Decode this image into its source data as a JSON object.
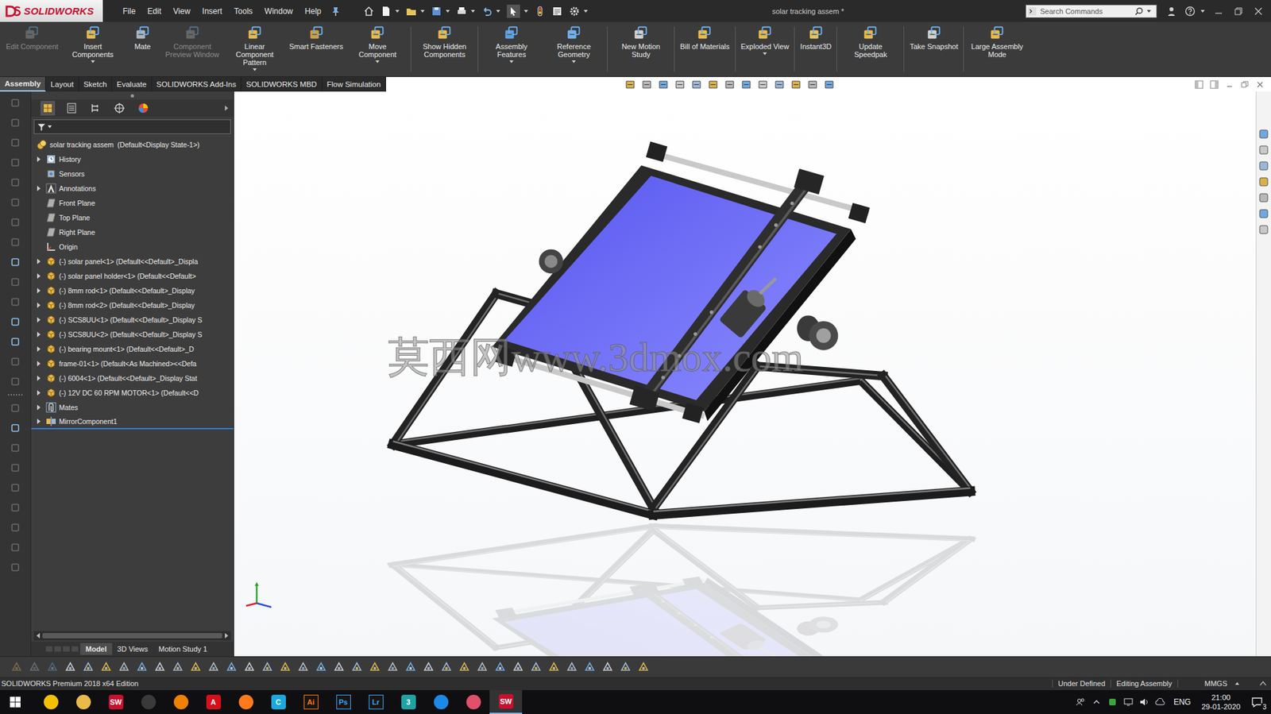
{
  "window": {
    "title": "solar tracking assem *",
    "app": "SOLIDWORKS"
  },
  "menu": [
    "File",
    "Edit",
    "View",
    "Insert",
    "Tools",
    "Window",
    "Help"
  ],
  "search": {
    "placeholder": "Search Commands"
  },
  "ribbon": [
    {
      "label": "Edit Component",
      "disabled": true,
      "dropdown": false
    },
    {
      "label": "Insert Components",
      "disabled": false,
      "dropdown": true
    },
    {
      "label": "Mate",
      "disabled": false,
      "dropdown": false
    },
    {
      "label": "Component Preview Window",
      "disabled": true,
      "dropdown": false
    },
    {
      "label": "Linear Component Pattern",
      "disabled": false,
      "dropdown": true
    },
    {
      "label": "Smart Fasteners",
      "disabled": false,
      "dropdown": false
    },
    {
      "label": "Move Component",
      "disabled": false,
      "dropdown": true
    },
    {
      "label": "Show Hidden Components",
      "disabled": false,
      "dropdown": false
    },
    {
      "label": "Assembly Features",
      "disabled": false,
      "dropdown": true
    },
    {
      "label": "Reference Geometry",
      "disabled": false,
      "dropdown": true
    },
    {
      "label": "New Motion Study",
      "disabled": false,
      "dropdown": false
    },
    {
      "label": "Bill of Materials",
      "disabled": false,
      "dropdown": false
    },
    {
      "label": "Exploded View",
      "disabled": false,
      "dropdown": true
    },
    {
      "label": "Instant3D",
      "disabled": false,
      "dropdown": false
    },
    {
      "label": "Update Speedpak",
      "disabled": false,
      "dropdown": false
    },
    {
      "label": "Take Snapshot",
      "disabled": false,
      "dropdown": false
    },
    {
      "label": "Large Assembly Mode",
      "disabled": false,
      "dropdown": false
    }
  ],
  "command_tabs": [
    {
      "label": "Assembly",
      "selected": true
    },
    {
      "label": "Layout",
      "selected": false
    },
    {
      "label": "Sketch",
      "selected": false
    },
    {
      "label": "Evaluate",
      "selected": false
    },
    {
      "label": "SOLIDWORKS Add-Ins",
      "selected": false
    },
    {
      "label": "SOLIDWORKS MBD",
      "selected": false
    },
    {
      "label": "Flow Simulation",
      "selected": false
    }
  ],
  "tree": {
    "root": "solar tracking assem  (Default<Display State-1>)",
    "items": [
      {
        "label": "History",
        "kind": "history",
        "expandable": true,
        "highlighted": false
      },
      {
        "label": "Sensors",
        "kind": "sensor",
        "expandable": false,
        "highlighted": false
      },
      {
        "label": "Annotations",
        "kind": "annotation",
        "expandable": true,
        "highlighted": false
      },
      {
        "label": "Front Plane",
        "kind": "plane",
        "expandable": false,
        "highlighted": false
      },
      {
        "label": "Top Plane",
        "kind": "plane",
        "expandable": false,
        "highlighted": false
      },
      {
        "label": "Right Plane",
        "kind": "plane",
        "expandable": false,
        "highlighted": false
      },
      {
        "label": "Origin",
        "kind": "origin",
        "expandable": false,
        "highlighted": false
      },
      {
        "label": "(-) solar panel<1> (Default<<Default>_Displa",
        "kind": "component",
        "expandable": true,
        "highlighted": false
      },
      {
        "label": "(-) solar panel holder<1> (Default<<Default>",
        "kind": "component",
        "expandable": true,
        "highlighted": false
      },
      {
        "label": "(-) 8mm rod<1> (Default<<Default>_Display",
        "kind": "component",
        "expandable": true,
        "highlighted": false
      },
      {
        "label": "(-) 8mm rod<2> (Default<<Default>_Display",
        "kind": "component",
        "expandable": true,
        "highlighted": false
      },
      {
        "label": "(-) SCS8UU<1> (Default<<Default>_Display S",
        "kind": "component",
        "expandable": true,
        "highlighted": false
      },
      {
        "label": "(-) SCS8UU<2> (Default<<Default>_Display S",
        "kind": "component",
        "expandable": true,
        "highlighted": false
      },
      {
        "label": "(-) bearing mount<1> (Default<<Default>_D",
        "kind": "component",
        "expandable": true,
        "highlighted": false
      },
      {
        "label": "frame-01<1> (Default<As Machined><<Defa",
        "kind": "component",
        "expandable": true,
        "highlighted": false
      },
      {
        "label": "(-) 6004<1> (Default<<Default>_Display Stat",
        "kind": "component",
        "expandable": true,
        "highlighted": false
      },
      {
        "label": "(-) 12V DC 60 RPM MOTOR<1> (Default<<D",
        "kind": "component",
        "expandable": true,
        "highlighted": false
      },
      {
        "label": "Mates",
        "kind": "mates",
        "expandable": true,
        "highlighted": false
      },
      {
        "label": "MirrorComponent1",
        "kind": "mirror",
        "expandable": true,
        "highlighted": true
      }
    ]
  },
  "panel_tabs": [
    {
      "label": "Model",
      "selected": true
    },
    {
      "label": "3D Views",
      "selected": false
    },
    {
      "label": "Motion Study 1",
      "selected": false
    }
  ],
  "watermark": "莫西网www.3dmox.com",
  "status_bar": {
    "edition": "SOLIDWORKS Premium 2018 x64 Edition",
    "state": "Under Defined",
    "mode": "Editing Assembly",
    "units": "MMGS"
  },
  "taskbar": {
    "apps": [
      {
        "glyph": "",
        "kind": "disc",
        "color": "#f2c200",
        "active": false
      },
      {
        "glyph": "",
        "kind": "disc",
        "color": "#e9b949",
        "active": false
      },
      {
        "glyph": "SW",
        "kind": "tile",
        "color": "#c8102e",
        "active": false
      },
      {
        "glyph": "",
        "kind": "disc",
        "color": "#3a3a3a",
        "active": false
      },
      {
        "glyph": "",
        "kind": "disc",
        "color": "#f08000",
        "active": false
      },
      {
        "glyph": "A",
        "kind": "tile",
        "color": "#d4111a",
        "active": false
      },
      {
        "glyph": "",
        "kind": "disc",
        "color": "#ff7a1a",
        "active": false
      },
      {
        "glyph": "C",
        "kind": "tile",
        "color": "#19a9e0",
        "active": false
      },
      {
        "glyph": "Ai",
        "kind": "glyph",
        "color": "#ff7c00",
        "active": false
      },
      {
        "glyph": "Ps",
        "kind": "glyph",
        "color": "#31a8ff",
        "active": false
      },
      {
        "glyph": "Lr",
        "kind": "glyph",
        "color": "#31a8ff",
        "active": false
      },
      {
        "glyph": "3",
        "kind": "tile",
        "color": "#1fa3a3",
        "active": false
      },
      {
        "glyph": "",
        "kind": "disc",
        "color": "#1e88e5",
        "active": false
      },
      {
        "glyph": "",
        "kind": "disc",
        "color": "#e0506a",
        "active": false
      },
      {
        "glyph": "SW",
        "kind": "tile",
        "color": "#c8102e",
        "active": true
      }
    ],
    "language": "ENG",
    "time": "21:00",
    "date": "29-01-2020",
    "notifications": "3"
  }
}
